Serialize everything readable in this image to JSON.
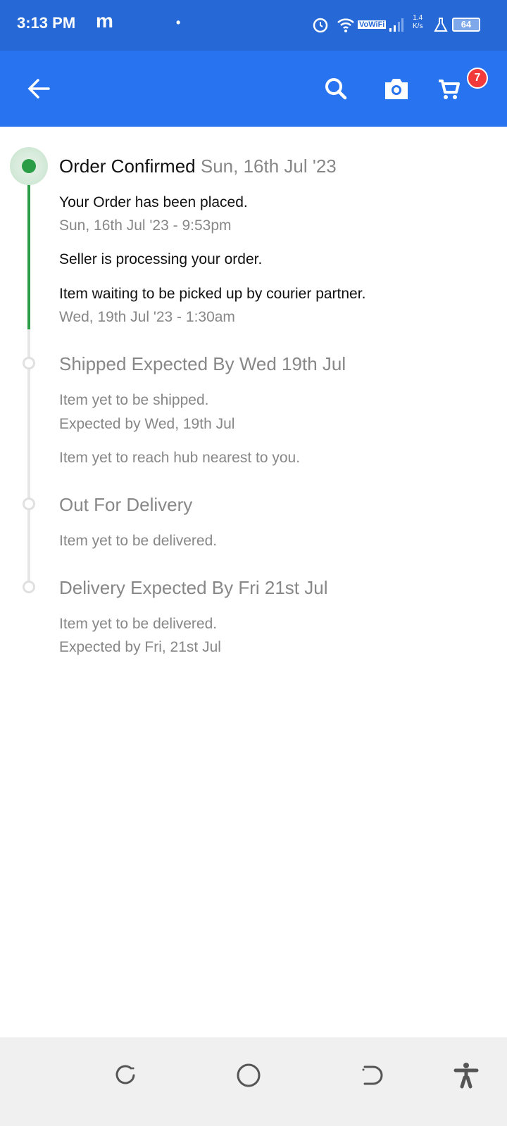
{
  "status_bar": {
    "time": "3:13 PM",
    "net_speed_value": "1.4",
    "net_speed_unit": "K/s",
    "wifi_label": "VoWiFi",
    "battery": "64"
  },
  "header": {
    "cart_count": "7",
    "icons": [
      "back-arrow-icon",
      "search-icon",
      "camera-icon",
      "cart-icon"
    ]
  },
  "colors": {
    "header": "#2874f0",
    "status_bar": "#2668d6",
    "done": "#2a9d46",
    "pending": "#e0e0e0",
    "badge": "#f33a3a"
  },
  "timeline": [
    {
      "title": "Order Confirmed",
      "date": "Sun, 16th Jul '23",
      "status": "done",
      "events": [
        {
          "text": "Your Order has been placed.",
          "time": "Sun, 16th Jul '23 - 9:53pm"
        },
        {
          "text": "Seller is processing your order."
        },
        {
          "text": "Item waiting to be picked up by courier partner.",
          "time": "Wed, 19th Jul '23 - 1:30am"
        }
      ]
    },
    {
      "title": "Shipped Expected By Wed 19th Jul",
      "status": "pending",
      "events": [
        {
          "text": "Item yet to be shipped.",
          "time": "Expected by Wed, 19th Jul"
        },
        {
          "text": "Item yet to reach hub nearest to you."
        }
      ]
    },
    {
      "title": "Out For Delivery",
      "status": "pending",
      "events": [
        {
          "text": "Item yet to be delivered."
        }
      ]
    },
    {
      "title": "Delivery Expected By Fri 21st Jul",
      "status": "pending",
      "events": [
        {
          "text": "Item yet to be delivered.",
          "time": "Expected by Fri, 21st Jul"
        }
      ]
    }
  ]
}
